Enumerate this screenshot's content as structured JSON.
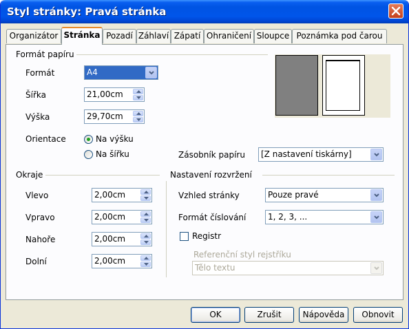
{
  "window": {
    "title": "Styl stránky: Pravá stránka"
  },
  "tabs": [
    {
      "label": "Organizátor"
    },
    {
      "label": "Stránka"
    },
    {
      "label": "Pozadí"
    },
    {
      "label": "Záhlaví"
    },
    {
      "label": "Zápatí"
    },
    {
      "label": "Ohraničení"
    },
    {
      "label": "Sloupce"
    },
    {
      "label": "Poznámka pod čarou"
    }
  ],
  "active_tab": "Stránka",
  "paper": {
    "group_title": "Formát papíru",
    "format_label": "Formát",
    "format_value": "A4",
    "width_label": "Šířka",
    "width_value": "21,00cm",
    "height_label": "Výška",
    "height_value": "29,70cm",
    "orientation_label": "Orientace",
    "portrait_label": "Na výšku",
    "landscape_label": "Na šířku",
    "orientation_selected": "Na výšku",
    "tray_label": "Zásobník papíru",
    "tray_value": "[Z nastavení tiskárny]"
  },
  "margins": {
    "group_title": "Okraje",
    "left_label": "Vlevo",
    "left_value": "2,00cm",
    "right_label": "Vpravo",
    "right_value": "2,00cm",
    "top_label": "Nahoře",
    "top_value": "2,00cm",
    "bottom_label": "Dolní",
    "bottom_value": "2,00cm"
  },
  "layout": {
    "group_title": "Nastavení rozvržení",
    "page_layout_label": "Vzhled stránky",
    "page_layout_value": "Pouze pravé",
    "numbering_label": "Formát číslování",
    "numbering_value": "1, 2, 3, ...",
    "register_label": "Registr",
    "register_checked": false,
    "ref_style_label": "Referenční styl rejstříku",
    "ref_style_value": "Tělo textu"
  },
  "buttons": {
    "ok": "OK",
    "cancel": "Zrušit",
    "help": "Nápověda",
    "reset": "Obnovit"
  },
  "colors": {
    "titlebar": "#0054e3",
    "dialog_bg": "#ece9d8",
    "tab_accent": "#e68b2c",
    "radio_dot": "#21a121",
    "preview_gray": "#808080"
  }
}
